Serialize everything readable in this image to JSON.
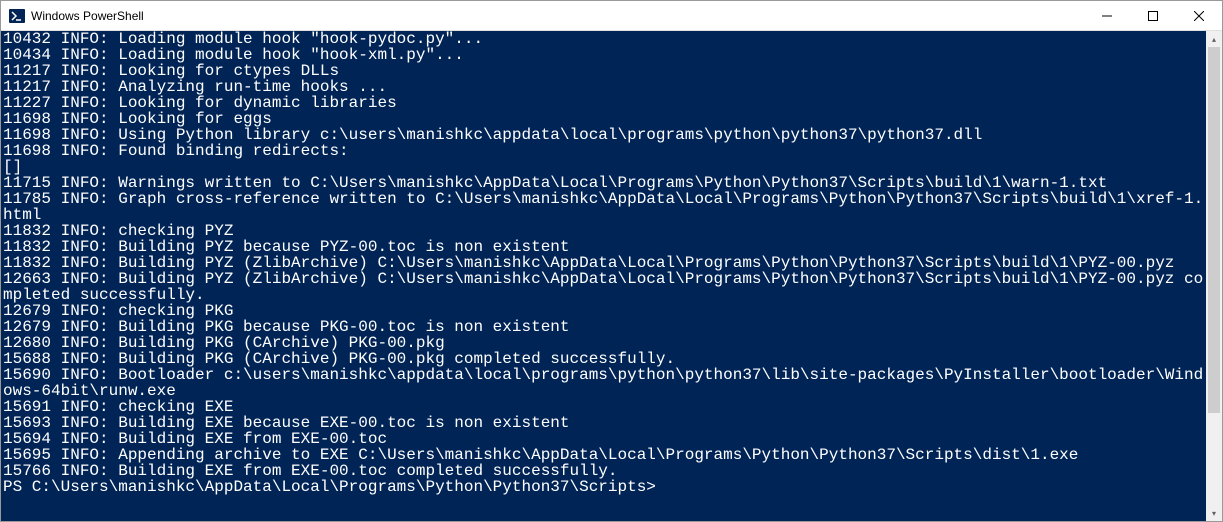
{
  "window": {
    "title": "Windows PowerShell"
  },
  "terminal": {
    "lines": [
      "10432 INFO: Loading module hook \"hook-pydoc.py\"...",
      "10434 INFO: Loading module hook \"hook-xml.py\"...",
      "11217 INFO: Looking for ctypes DLLs",
      "11217 INFO: Analyzing run-time hooks ...",
      "11227 INFO: Looking for dynamic libraries",
      "11698 INFO: Looking for eggs",
      "11698 INFO: Using Python library c:\\users\\manishkc\\appdata\\local\\programs\\python\\python37\\python37.dll",
      "11698 INFO: Found binding redirects:",
      "[]",
      "11715 INFO: Warnings written to C:\\Users\\manishkc\\AppData\\Local\\Programs\\Python\\Python37\\Scripts\\build\\1\\warn-1.txt",
      "11785 INFO: Graph cross-reference written to C:\\Users\\manishkc\\AppData\\Local\\Programs\\Python\\Python37\\Scripts\\build\\1\\xref-1.html",
      "11832 INFO: checking PYZ",
      "11832 INFO: Building PYZ because PYZ-00.toc is non existent",
      "11832 INFO: Building PYZ (ZlibArchive) C:\\Users\\manishkc\\AppData\\Local\\Programs\\Python\\Python37\\Scripts\\build\\1\\PYZ-00.pyz",
      "12663 INFO: Building PYZ (ZlibArchive) C:\\Users\\manishkc\\AppData\\Local\\Programs\\Python\\Python37\\Scripts\\build\\1\\PYZ-00.pyz completed successfully.",
      "12679 INFO: checking PKG",
      "12679 INFO: Building PKG because PKG-00.toc is non existent",
      "12680 INFO: Building PKG (CArchive) PKG-00.pkg",
      "15688 INFO: Building PKG (CArchive) PKG-00.pkg completed successfully.",
      "15690 INFO: Bootloader c:\\users\\manishkc\\appdata\\local\\programs\\python\\python37\\lib\\site-packages\\PyInstaller\\bootloader\\Windows-64bit\\runw.exe",
      "15691 INFO: checking EXE",
      "15693 INFO: Building EXE because EXE-00.toc is non existent",
      "15694 INFO: Building EXE from EXE-00.toc",
      "15695 INFO: Appending archive to EXE C:\\Users\\manishkc\\AppData\\Local\\Programs\\Python\\Python37\\Scripts\\dist\\1.exe",
      "15766 INFO: Building EXE from EXE-00.toc completed successfully."
    ],
    "prompt": "PS C:\\Users\\manishkc\\AppData\\Local\\Programs\\Python\\Python37\\Scripts>"
  }
}
